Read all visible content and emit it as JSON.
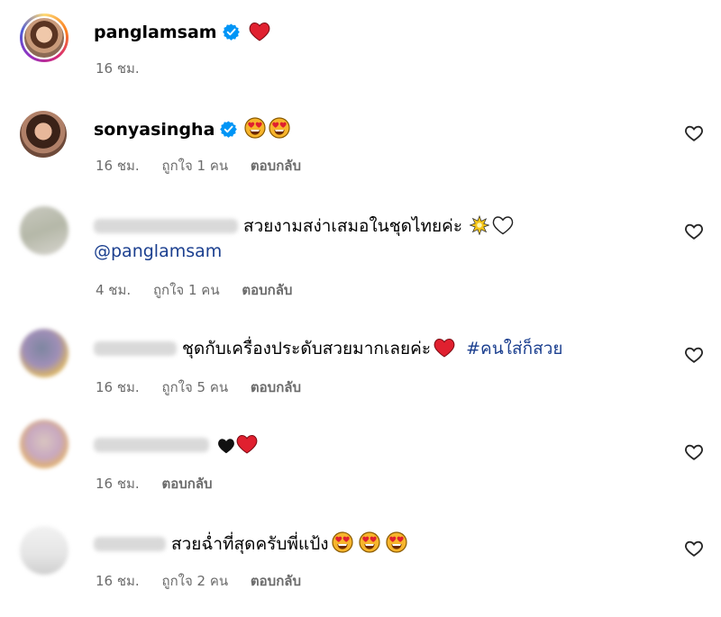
{
  "comments": [
    {
      "username": "panglamsam",
      "time": "16 ชม."
    },
    {
      "username": "sonyasingha",
      "time": "16 ชม.",
      "likes": "ถูกใจ 1 คน",
      "reply": "ตอบกลับ"
    },
    {
      "text": "สวยงามสง่าเสมอในชุดไทยค่ะ",
      "mention": "@panglamsam",
      "time": "4 ชม.",
      "likes": "ถูกใจ 1 คน",
      "reply": "ตอบกลับ"
    },
    {
      "text": "ชุดกับเครื่องประดับสวยมากเลยค่ะ",
      "hashtag": "#คนใส่ก็สวย",
      "time": "16 ชม.",
      "likes": "ถูกใจ 5 คน",
      "reply": "ตอบกลับ"
    },
    {
      "time": "16 ชม.",
      "reply": "ตอบกลับ"
    },
    {
      "text": "สวยฉ่ำที่สุดครับพี่แป้ง",
      "time": "16 ชม.",
      "likes": "ถูกใจ 2 คน",
      "reply": "ตอบกลับ"
    }
  ],
  "icons": {
    "verified": "verified-badge-icon",
    "like": "heart-outline-icon",
    "emoji_heart": "red-heart-emoji",
    "emoji_heart_eyes": "heart-eyes-emoji",
    "emoji_sparkle": "sparkle-emoji",
    "emoji_white_heart": "white-heart-emoji",
    "emoji_black_heart": "black-heart-emoji"
  },
  "colors": {
    "verified": "#0095f6",
    "link": "#1b3f8f",
    "meta": "#6b6b6b",
    "red_heart": "#e0202f"
  }
}
